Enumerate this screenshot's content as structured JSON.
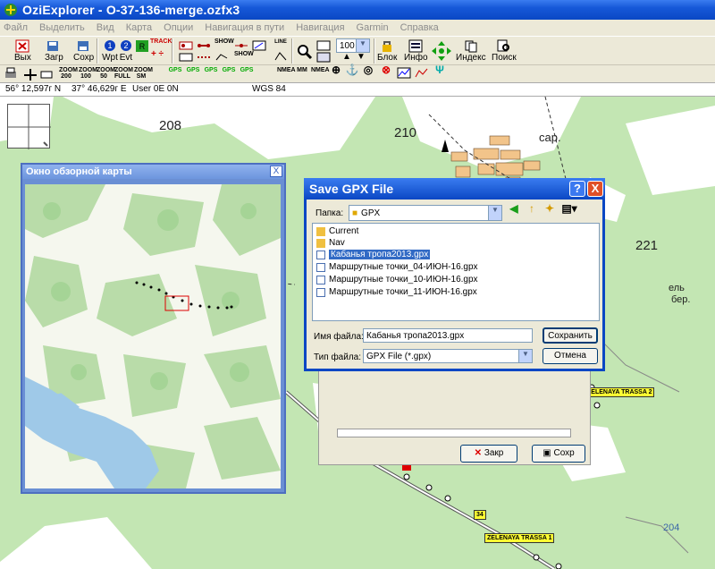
{
  "window": {
    "title": "OziExplorer - O-37-136-merge.ozfx3"
  },
  "menu": [
    "Файл",
    "Выделить",
    "Вид",
    "Карта",
    "Опции",
    "Навигация в пути",
    "Навигация",
    "Garmin",
    "Справка"
  ],
  "toolbar1": {
    "exit": "Вых",
    "load": "Загр",
    "save": "Сохр",
    "wpt_num": "1",
    "wpt": "Wpt",
    "evt_num": "2",
    "evt": "Evt",
    "track": "TRACK",
    "zoom_value": "100",
    "block": "Блок",
    "info": "Инфо",
    "index": "Индекс",
    "search": "Поиск",
    "show": "SHOW",
    "line": "LINE"
  },
  "toolbar2": {
    "zoom200": "ZOOM 200",
    "zoom100": "ZOOM 100",
    "zoom50": "ZOOM 50",
    "zoomfull": "ZOOM FULL",
    "zoomsm": "ZOOM SM",
    "gps": "GPS",
    "nmea": "NMEA",
    "mm": "MM"
  },
  "status": {
    "lat": "56° 12,597г N",
    "lon": "37° 46,629г E",
    "user": "User 0E  0N",
    "datum": "WGS 84"
  },
  "map": {
    "labels": [
      "208",
      "210",
      "221",
      "сар.",
      "ель",
      "бер."
    ],
    "road_tags": [
      "ZELENAYA TRASSA 2",
      "34",
      "ZELENAYA TRASSA 1"
    ],
    "contour": "204"
  },
  "overview": {
    "title": "Окно обзорной карты",
    "close": "X"
  },
  "dialog": {
    "title": "Save GPX File",
    "help": "?",
    "close": "X",
    "folder_label": "Папка:",
    "folder_value": "GPX",
    "items": [
      {
        "name": "Current",
        "type": "folder"
      },
      {
        "name": "Nav",
        "type": "folder"
      },
      {
        "name": "Кабанья тропа2013.gpx",
        "type": "file",
        "selected": true
      },
      {
        "name": "Маршрутные точки_04-ИЮН-16.gpx",
        "type": "file"
      },
      {
        "name": "Маршрутные точки_10-ИЮН-16.gpx",
        "type": "file"
      },
      {
        "name": "Маршрутные точки_11-ИЮН-16.gpx",
        "type": "file"
      }
    ],
    "filename_label": "Имя файла:",
    "filename_value": "Кабанья тропа2013.gpx",
    "filetype_label": "Тип файла:",
    "filetype_value": "GPX File (*.gpx)",
    "save_button": "Сохранить",
    "cancel_button": "Отмена"
  },
  "behind_dialog": {
    "close_button": "Закр",
    "save_button": "Сохр"
  },
  "colors": {
    "title_blue": "#0a47c4",
    "map_green": "#c3e6b3",
    "water": "#9fc9e8"
  }
}
